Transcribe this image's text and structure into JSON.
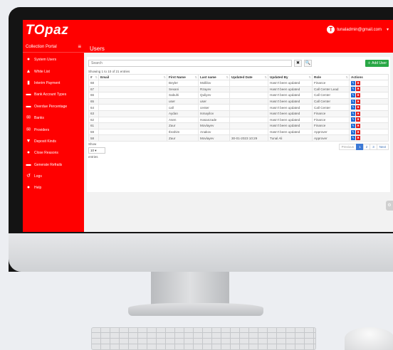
{
  "app": {
    "logo": "TOpaz",
    "user_initial": "T",
    "user_email": "tunaladmin@gmail.com"
  },
  "sidebar": {
    "portal_label": "Collection Portal",
    "items": [
      {
        "label": "System Users",
        "icon": "users-icon"
      },
      {
        "label": "White List",
        "icon": "user-icon"
      },
      {
        "label": "Interim Payment",
        "icon": "document-icon"
      },
      {
        "label": "Bank Account Types",
        "icon": "card-icon"
      },
      {
        "label": "Overdue Percentage",
        "icon": "card-icon"
      },
      {
        "label": "Banks",
        "icon": "envelope-icon"
      },
      {
        "label": "Providers",
        "icon": "envelope-icon"
      },
      {
        "label": "Deposit Kinds",
        "icon": "filter-icon"
      },
      {
        "label": "Close Reasons",
        "icon": "comment-icon"
      },
      {
        "label": "Generate Refrails",
        "icon": "card-icon"
      },
      {
        "label": "Logs",
        "icon": "history-icon"
      },
      {
        "label": "Help",
        "icon": "help-icon"
      }
    ]
  },
  "page": {
    "title": "Users"
  },
  "toolbar": {
    "search_placeholder": "Search",
    "clear_icon": "✖",
    "search_icon": "🔍",
    "add_label": "Add User"
  },
  "table": {
    "showing": "Showing 1 to 10 of 21 entries",
    "columns": [
      "#",
      "Email",
      "First Name",
      "Last name",
      "Updated Date",
      "Updated By",
      "Role",
      "Actions"
    ],
    "rows": [
      [
        "68",
        "",
        "Beyler",
        "Mollilov",
        "",
        "Hasn't been updated",
        "Finance"
      ],
      [
        "67",
        "",
        "Sexani",
        "Rzayev",
        "",
        "Hasn't been updated",
        "Call Center Lead"
      ],
      [
        "66",
        "",
        "Sabuhi",
        "Quliyev",
        "",
        "Hasn't been updated",
        "Call Center"
      ],
      [
        "65",
        "",
        "user",
        "user",
        "",
        "Hasn't been updated",
        "Call Center"
      ],
      [
        "64",
        "",
        "call",
        "center",
        "",
        "Hasn't been updated",
        "Call Center"
      ],
      [
        "63",
        "",
        "Aydan",
        "Ismayilov",
        "",
        "Hasn't been updated",
        "Finance"
      ],
      [
        "62",
        "",
        "Asen",
        "Hasanzade",
        "",
        "Hasn't been updated",
        "Finance"
      ],
      [
        "61",
        "",
        "Zaur",
        "Movlayev",
        "",
        "Hasn't been updated",
        "Finance"
      ],
      [
        "59",
        "",
        "Ibrahim",
        "Anakov",
        "",
        "Hasn't been updated",
        "Approver"
      ],
      [
        "58",
        "",
        "Zaur",
        "Movlayev",
        "30-01-2023 10:29",
        "Tunal Ali",
        "Approver"
      ]
    ]
  },
  "footer": {
    "show_label": "Show",
    "page_size": "10",
    "entries_label": "entries",
    "pager": [
      "Previous",
      "1",
      "2",
      "3",
      "Next"
    ]
  }
}
